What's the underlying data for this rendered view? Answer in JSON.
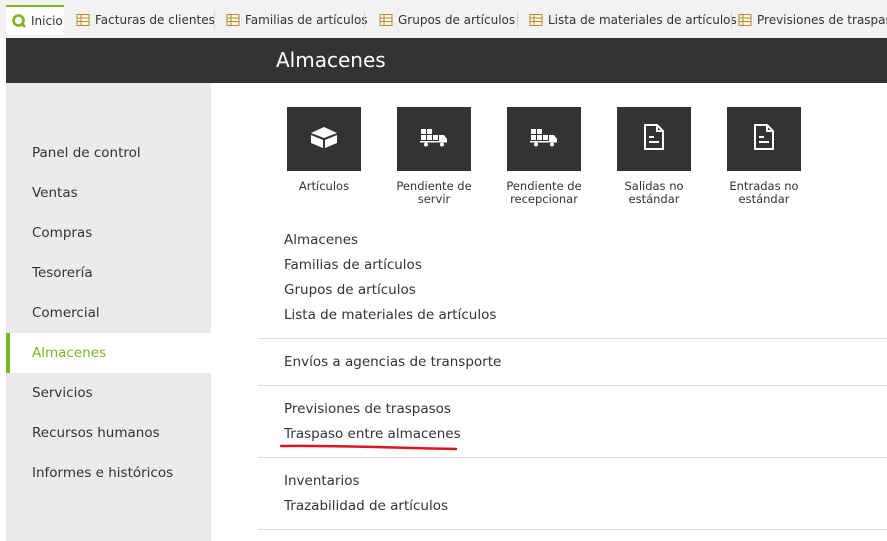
{
  "tabs": [
    {
      "label": "Inicio",
      "icon": "app-logo-icon",
      "active": true
    },
    {
      "label": "Facturas de clientes",
      "icon": "table-icon"
    },
    {
      "label": "Familias de artículos",
      "icon": "table-icon"
    },
    {
      "label": "Grupos de artículos",
      "icon": "table-icon"
    },
    {
      "label": "Lista de materiales de artículos",
      "icon": "table-icon"
    },
    {
      "label": "Previsiones de traspaso de",
      "icon": "table-icon"
    }
  ],
  "header": {
    "title": "Almacenes"
  },
  "sidebar": {
    "items": [
      {
        "label": "Panel de control"
      },
      {
        "label": "Ventas"
      },
      {
        "label": "Compras"
      },
      {
        "label": "Tesorería"
      },
      {
        "label": "Comercial"
      },
      {
        "label": "Almacenes",
        "active": true
      },
      {
        "label": "Servicios"
      },
      {
        "label": "Recursos humanos"
      },
      {
        "label": "Informes e históricos"
      }
    ]
  },
  "tiles": [
    {
      "line1": "Artículos",
      "line2": "",
      "icon": "box-icon"
    },
    {
      "line1": "Pendiente de",
      "line2": "servir",
      "icon": "truck-icon"
    },
    {
      "line1": "Pendiente de",
      "line2": "recepcionar",
      "icon": "truck-icon"
    },
    {
      "line1": "Salidas no",
      "line2": "estándar",
      "icon": "document-icon"
    },
    {
      "line1": "Entradas no",
      "line2": "estándar",
      "icon": "document-icon"
    }
  ],
  "links": {
    "group1": [
      "Almacenes",
      "Familias de artículos",
      "Grupos de artículos",
      "Lista de materiales de artículos"
    ],
    "group2": [
      "Envíos a agencias de transporte"
    ],
    "group3": [
      "Previsiones de traspasos",
      "Traspaso entre almacenes"
    ],
    "group4": [
      "Inventarios",
      "Trazabilidad de artículos"
    ]
  },
  "colors": {
    "accent": "#7ab51d",
    "header_bg": "#333333",
    "annotation": "#e0141e"
  }
}
